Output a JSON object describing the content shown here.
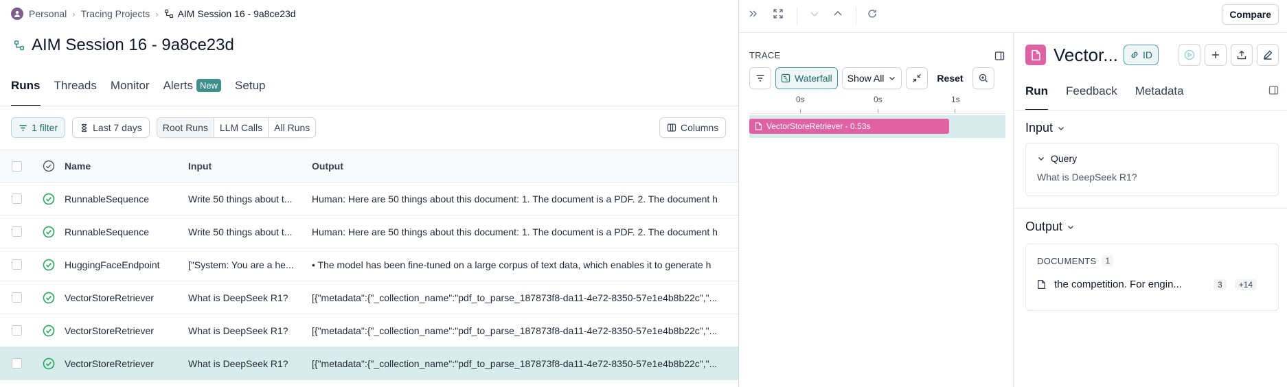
{
  "breadcrumb": {
    "workspace": "Personal",
    "section": "Tracing Projects",
    "current": "AIM Session 16 - 9a8ce23d"
  },
  "page": {
    "title": "AIM Session 16 - 9a8ce23d"
  },
  "tabs": [
    {
      "label": "Runs",
      "active": true
    },
    {
      "label": "Threads"
    },
    {
      "label": "Monitor"
    },
    {
      "label": "Alerts",
      "badge": "New"
    },
    {
      "label": "Setup"
    }
  ],
  "toolbar": {
    "filter_label": "1 filter",
    "time_range": "Last 7 days",
    "run_scope": [
      "Root Runs",
      "LLM Calls",
      "All Runs"
    ],
    "run_scope_selected": "Root Runs",
    "columns_label": "Columns"
  },
  "table": {
    "headers": {
      "name": "Name",
      "input": "Input",
      "output": "Output"
    },
    "rows": [
      {
        "name": "RunnableSequence",
        "input": "Write 50 things about t...",
        "output": "Human: Here are 50 things about this document: 1. The document is a PDF. 2. The document h",
        "status": "success"
      },
      {
        "name": "RunnableSequence",
        "input": "Write 50 things about t...",
        "output": "Human: Here are 50 things about this document: 1. The document is a PDF. 2. The document h",
        "status": "success"
      },
      {
        "name": "HuggingFaceEndpoint",
        "input": "[\"System: You are a he...",
        "output": "• The model has been fine-tuned on a large corpus of text data, which enables it to generate h",
        "status": "success"
      },
      {
        "name": "VectorStoreRetriever",
        "input": "What is DeepSeek R1?",
        "output": "[{\"metadata\":{\"_collection_name\":\"pdf_to_parse_187873f8-da11-4e72-8350-57e1e4b8b22c\",\"...",
        "status": "success"
      },
      {
        "name": "VectorStoreRetriever",
        "input": "What is DeepSeek R1?",
        "output": "[{\"metadata\":{\"_collection_name\":\"pdf_to_parse_187873f8-da11-4e72-8350-57e1e4b8b22c\",\"...",
        "status": "success"
      },
      {
        "name": "VectorStoreRetriever",
        "input": "What is DeepSeek R1?",
        "output": "[{\"metadata\":{\"_collection_name\":\"pdf_to_parse_187873f8-da11-4e72-8350-57e1e4b8b22c\",\"...",
        "status": "success",
        "selected": true
      }
    ]
  },
  "panel": {
    "compare_label": "Compare",
    "trace": {
      "label": "TRACE",
      "view_mode": "Waterfall",
      "show_filter": "Show All",
      "reset_label": "Reset",
      "ticks": [
        "0s",
        "0s",
        "1s"
      ],
      "bar_label": "VectorStoreRetriever - 0.53s",
      "bar_fraction": 0.78
    },
    "run": {
      "title": "Vector...",
      "id_label": "ID",
      "tabs": [
        "Run",
        "Feedback",
        "Metadata"
      ],
      "active_tab": "Run",
      "input_title": "Input",
      "query_label": "Query",
      "query_value": "What is DeepSeek R1?",
      "output_title": "Output",
      "documents_label": "DOCUMENTS",
      "documents_count": "1",
      "doc_snippet": "the competition. For engin...",
      "doc_badge": "3",
      "doc_more": "+14"
    }
  },
  "colors": {
    "accent": "#3f8f8c",
    "retriever": "#e062a4",
    "success": "#22a55a",
    "selected_row": "#d7eceb"
  }
}
